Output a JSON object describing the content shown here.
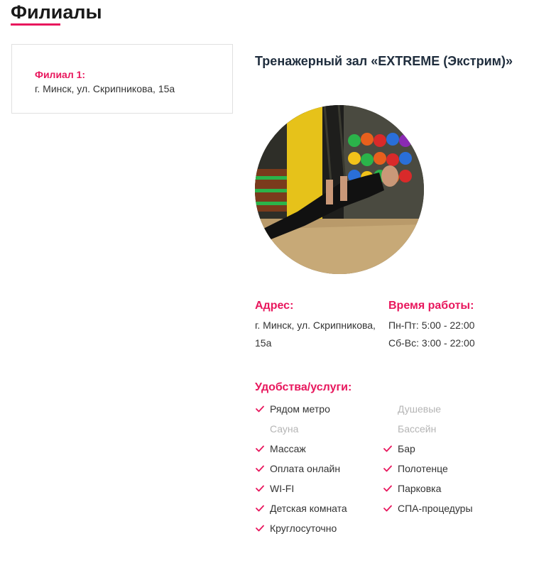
{
  "page": {
    "title": "Филиалы",
    "accent_color": "#e8175d"
  },
  "branch": {
    "name": "Филиал 1:",
    "address": "г. Минск, ул. Скрипникова, 15а"
  },
  "gym": {
    "title": "Тренажерный зал «EXTREME (Экстрим)»",
    "photo_subject": "man doing TRX suspension training in gym",
    "address_label": "Адрес:",
    "address_line1": "г. Минск, ул. Скрипникова,",
    "address_line2": "15а",
    "hours_label": "Время работы:",
    "hours_weekday": "Пн-Пт: 5:00 - 22:00",
    "hours_weekend": "Сб-Вс: 3:00 - 22:00"
  },
  "amenities": {
    "label": "Удобства/услуги:",
    "check_icon": "check-icon",
    "items": [
      {
        "label": "Рядом метро",
        "available": true
      },
      {
        "label": "Душевые",
        "available": false
      },
      {
        "label": "Сауна",
        "available": false
      },
      {
        "label": "Бассейн",
        "available": false
      },
      {
        "label": "Массаж",
        "available": true
      },
      {
        "label": "Бар",
        "available": true
      },
      {
        "label": "Оплата онлайн",
        "available": true
      },
      {
        "label": "Полотенце",
        "available": true
      },
      {
        "label": "WI-FI",
        "available": true
      },
      {
        "label": "Парковка",
        "available": true
      },
      {
        "label": "Детская комната",
        "available": true
      },
      {
        "label": "СПА-процедуры",
        "available": true
      },
      {
        "label": "Круглосуточно",
        "available": true
      }
    ]
  }
}
